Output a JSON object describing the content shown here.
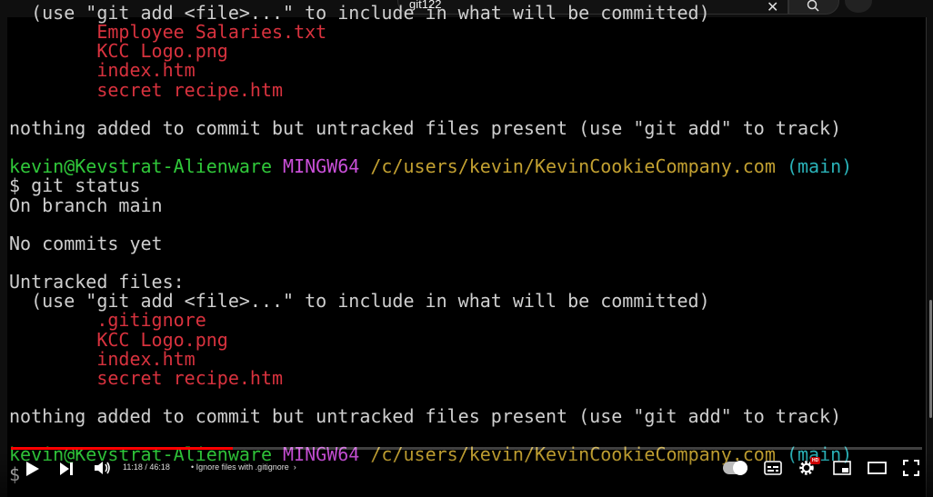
{
  "search": {
    "query": "git122"
  },
  "terminal": {
    "lines_top": [
      {
        "text": "  (use \"git add <file>...\" to include in what will be committed)",
        "cls": ""
      },
      {
        "text": "        Employee Salaries.txt",
        "cls": "red"
      },
      {
        "text": "        KCC Logo.png",
        "cls": "red"
      },
      {
        "text": "        index.htm",
        "cls": "red"
      },
      {
        "text": "        secret recipe.htm",
        "cls": "red"
      },
      {
        "text": "",
        "cls": ""
      },
      {
        "text": "nothing added to commit but untracked files present (use \"git add\" to track)",
        "cls": ""
      },
      {
        "text": "",
        "cls": ""
      }
    ],
    "prompt1": {
      "user": "kevin@Kevstrat-Alienware",
      "env": "MINGW64",
      "path": "/c/users/kevin/KevinCookieCompany.com",
      "branch": "(main)"
    },
    "command": "$ git status",
    "lines_mid": [
      {
        "text": "On branch main",
        "cls": ""
      },
      {
        "text": "",
        "cls": ""
      },
      {
        "text": "No commits yet",
        "cls": ""
      },
      {
        "text": "",
        "cls": ""
      },
      {
        "text": "Untracked files:",
        "cls": ""
      },
      {
        "text": "  (use \"git add <file>...\" to include in what will be committed)",
        "cls": ""
      },
      {
        "text": "        .gitignore",
        "cls": "red"
      },
      {
        "text": "        KCC Logo.png",
        "cls": "red"
      },
      {
        "text": "        index.htm",
        "cls": "red"
      },
      {
        "text": "        secret recipe.htm",
        "cls": "red"
      },
      {
        "text": "",
        "cls": ""
      },
      {
        "text": "nothing added to commit but untracked files present (use \"git add\" to track)",
        "cls": ""
      },
      {
        "text": "",
        "cls": ""
      }
    ],
    "prompt2": {
      "user": "kevin@Kevstrat-Alienware",
      "env": "MINGW64",
      "path": "/c/users/kevin/KevinCookieCompany.com",
      "branch": "(main)"
    },
    "cursor_prompt": "$"
  },
  "player": {
    "current_time": "11:18",
    "duration": "46:18",
    "time_display": "11:18 / 46:18",
    "chapter": "Ignore files with .gitignore",
    "progress_fraction": 0.244,
    "accent": "#ff0000",
    "icons": [
      "play-icon",
      "next-icon",
      "volume-icon",
      "autoplay-toggle",
      "subtitles-icon",
      "settings-icon",
      "miniplayer-icon",
      "theater-icon",
      "fullscreen-icon"
    ],
    "hd_badge": "HD"
  }
}
